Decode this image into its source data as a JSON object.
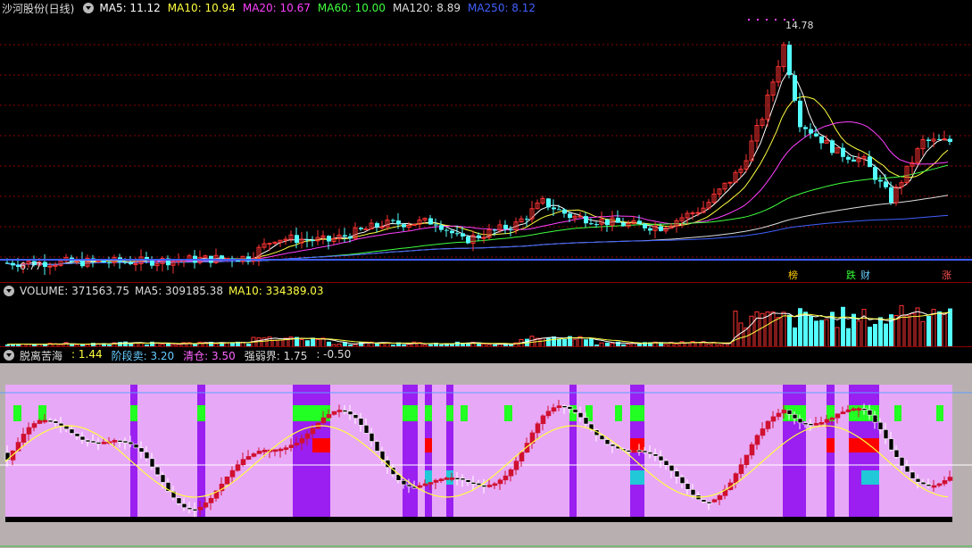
{
  "main": {
    "title": "沙河股份(日线)",
    "ma": [
      {
        "label": "MA5: 11.12",
        "color": "#ffffff"
      },
      {
        "label": "MA10: 10.94",
        "color": "#ffff40"
      },
      {
        "label": "MA20: 10.67",
        "color": "#ff40ff"
      },
      {
        "label": "MA60: 10.00",
        "color": "#40ff40"
      },
      {
        "label": "MA120: 8.89",
        "color": "#dddddd"
      },
      {
        "label": "MA250: 8.12",
        "color": "#4060ff"
      }
    ],
    "high_label": "14.78",
    "low_label": "6.77",
    "tags": [
      {
        "text": "榜",
        "color": "#ffcc00"
      },
      {
        "text": "跌",
        "color": "#33ff33"
      },
      {
        "text": "财",
        "color": "#66ccff"
      },
      {
        "text": "涨",
        "color": "#ff5050"
      }
    ]
  },
  "volume": {
    "items": [
      {
        "label": "VOLUME: 371563.75",
        "color": "#dddddd"
      },
      {
        "label": "MA5: 309185.38",
        "color": "#dddddd"
      },
      {
        "label": "MA10: 334389.03",
        "color": "#ffff40"
      }
    ]
  },
  "indicator": {
    "items": [
      {
        "label": "脱离苦海",
        "color": "#dddddd"
      },
      {
        "label": ": 1.44",
        "color": "#ffff40"
      },
      {
        "label": "阶段卖: 3.20",
        "color": "#66ccff"
      },
      {
        "label": "清仓: 3.50",
        "color": "#ff66ff"
      },
      {
        "label": "强弱界: 1.75",
        "color": "#dddddd"
      },
      {
        "label": ": -0.50",
        "color": "#dddddd"
      }
    ]
  },
  "colors": {
    "up": "#ff3333",
    "down": "#54ffff",
    "grid": "#8b0000",
    "pink_bg": "#e8a8f8",
    "purple": "#9a1ff0",
    "green_band": "#22ff22",
    "red_band": "#ff0000",
    "cyan_band": "#20c8d8"
  }
}
